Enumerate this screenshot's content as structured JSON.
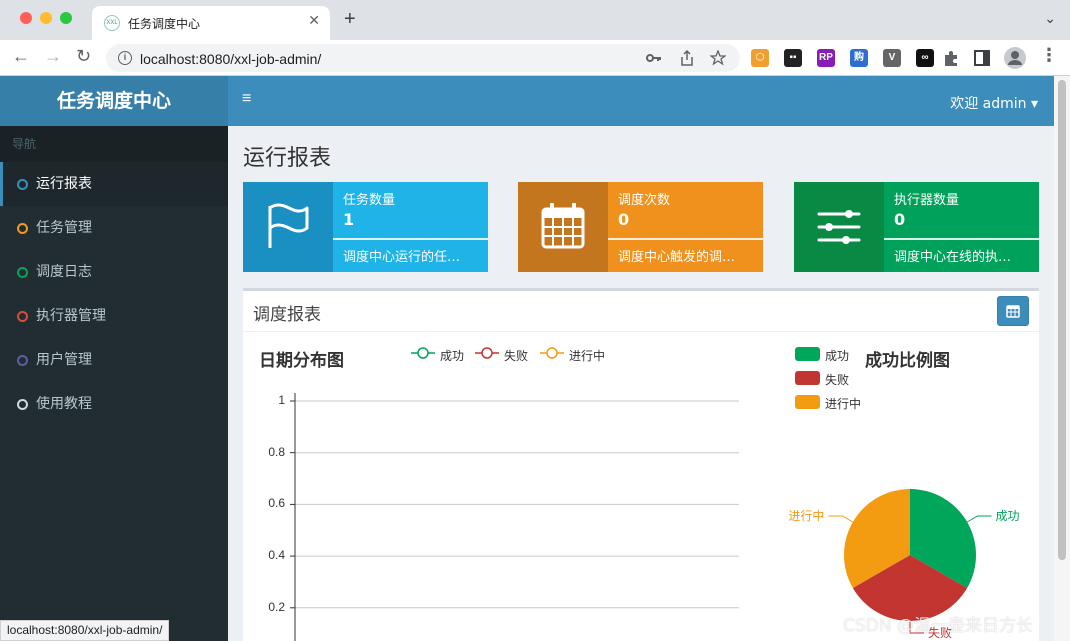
{
  "browser": {
    "tab_title": "任务调度中心",
    "favicon_text": "XXL",
    "close_glyph": "✕",
    "new_tab_glyph": "+",
    "tab_menu_glyph": "⌄",
    "url": "localhost:8080/xxl-job-admin/",
    "status_url": "localhost:8080/xxl-job-admin/",
    "back_glyph": "←",
    "forward_glyph": "→",
    "reload_glyph": "↻",
    "info_glyph": "i",
    "extensions": [
      {
        "name": "ext-hex",
        "color": "#f0a030",
        "text": "⬡"
      },
      {
        "name": "ext-tampermonkey",
        "color": "#222222",
        "text": "▪▪"
      },
      {
        "name": "ext-rp",
        "color": "#8a1bb5",
        "text": "RP"
      },
      {
        "name": "ext-translate",
        "color": "#2d6ecf",
        "text": "购"
      },
      {
        "name": "ext-vue",
        "color": "#666666",
        "text": "V"
      },
      {
        "name": "ext-infinity",
        "color": "#111111",
        "text": "∞"
      }
    ]
  },
  "app": {
    "logo": "任务调度中心",
    "nav_header": "导航",
    "nav_items": [
      {
        "label": "运行报表",
        "dot": "#3c8dbc",
        "active": true
      },
      {
        "label": "任务管理",
        "dot": "#f39c12",
        "active": false
      },
      {
        "label": "调度日志",
        "dot": "#00a65a",
        "active": false
      },
      {
        "label": "执行器管理",
        "dot": "#dd4b39",
        "active": false
      },
      {
        "label": "用户管理",
        "dot": "#605ca8",
        "active": false
      },
      {
        "label": "使用教程",
        "dot": "#d2d6de",
        "active": false
      }
    ],
    "hamburger_glyph": "≡",
    "user_menu": "欢迎 admin ▾"
  },
  "page": {
    "title": "运行报表",
    "info_boxes": [
      {
        "label": "任务数量",
        "value": "1",
        "desc": "调度中心运行的任…",
        "icon": "flag-icon",
        "icon_bg": "#1a8fc2",
        "body_bg": "#1fb3e8"
      },
      {
        "label": "调度次数",
        "value": "0",
        "desc": "调度中心触发的调…",
        "icon": "calendar-icon",
        "icon_bg": "#c4761e",
        "body_bg": "#f0911e"
      },
      {
        "label": "执行器数量",
        "value": "0",
        "desc": "调度中心在线的执…",
        "icon": "sliders-icon",
        "icon_bg": "#088a45",
        "body_bg": "#00a15a"
      }
    ],
    "report": {
      "title": "调度报表",
      "date_button_icon": "calendar-icon"
    }
  },
  "chart_data": [
    {
      "type": "line",
      "title": "日期分布图",
      "series": [
        {
          "name": "成功",
          "color": "#00a65a",
          "values": []
        },
        {
          "name": "失败",
          "color": "#c23531",
          "values": []
        },
        {
          "name": "进行中",
          "color": "#f39c12",
          "values": []
        }
      ],
      "ylim": [
        0,
        1
      ],
      "yticks": [
        "1",
        "0.8",
        "0.6",
        "0.4",
        "0.2"
      ],
      "legend": "top"
    },
    {
      "type": "pie",
      "title": "成功比例图",
      "slices": [
        {
          "name": "成功",
          "value": 1,
          "color": "#00a65a"
        },
        {
          "name": "失败",
          "value": 1,
          "color": "#c23531"
        },
        {
          "name": "进行中",
          "value": 1,
          "color": "#f39c12"
        }
      ],
      "legend": "top-left"
    }
  ],
  "watermark": "CSDN @温一壶来日方长"
}
